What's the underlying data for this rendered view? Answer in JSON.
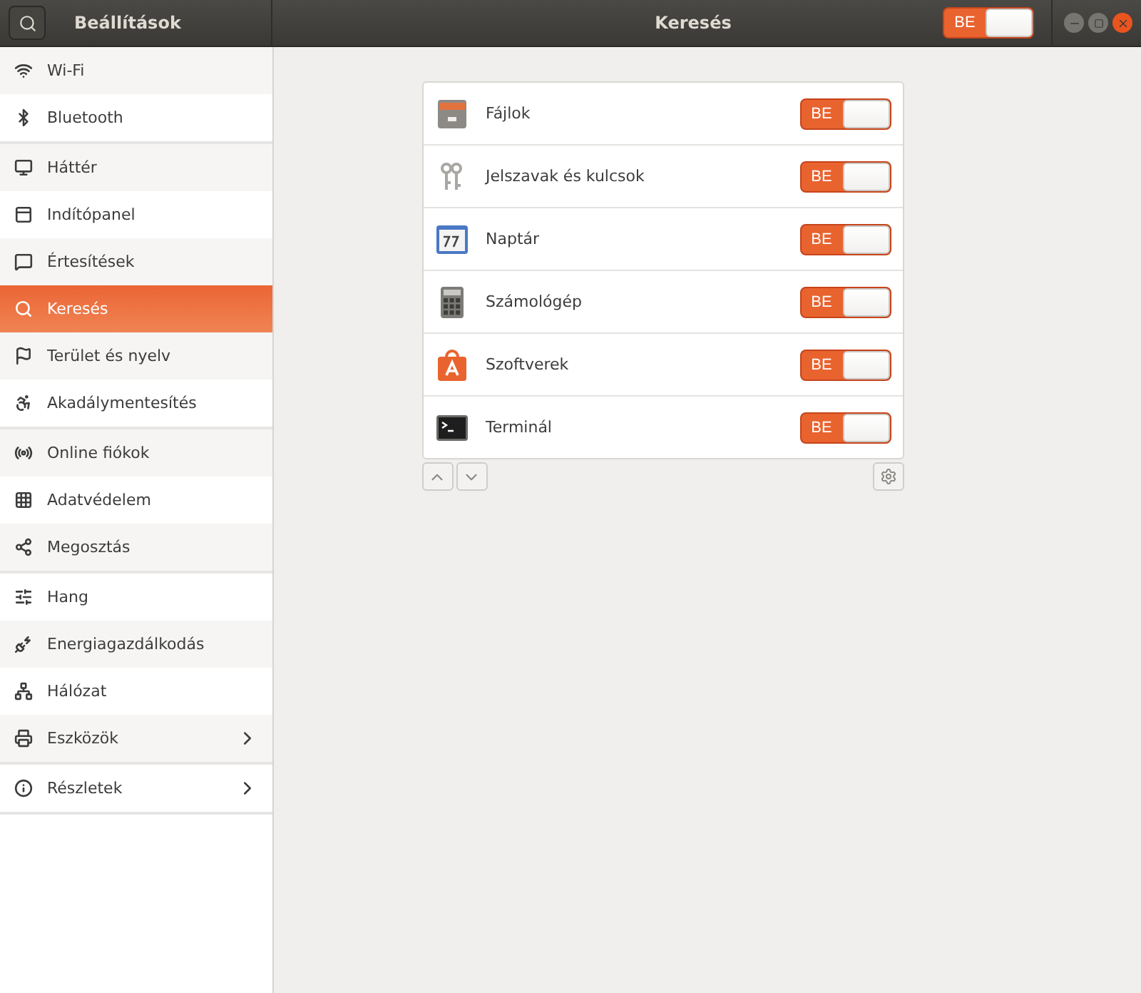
{
  "window": {
    "app_title": "Beállítások",
    "title": "Keresés",
    "master_switch": {
      "label": "BE",
      "on": true
    }
  },
  "sidebar": {
    "sections": [
      {
        "items": [
          {
            "label": "Wi-Fi",
            "selected": false,
            "arrow": false
          },
          {
            "label": "Bluetooth",
            "selected": false,
            "arrow": false
          }
        ]
      },
      {
        "items": [
          {
            "label": "Háttér",
            "selected": false,
            "arrow": false
          },
          {
            "label": "Indítópanel",
            "selected": false,
            "arrow": false
          },
          {
            "label": "Értesítések",
            "selected": false,
            "arrow": false
          },
          {
            "label": "Keresés",
            "selected": true,
            "arrow": false
          },
          {
            "label": "Terület és nyelv",
            "selected": false,
            "arrow": false
          },
          {
            "label": "Akadálymentesítés",
            "selected": false,
            "arrow": false
          }
        ]
      },
      {
        "items": [
          {
            "label": "Online fiókok",
            "selected": false,
            "arrow": false
          },
          {
            "label": "Adatvédelem",
            "selected": false,
            "arrow": false
          },
          {
            "label": "Megosztás",
            "selected": false,
            "arrow": false
          }
        ]
      },
      {
        "items": [
          {
            "label": "Hang",
            "selected": false,
            "arrow": false
          },
          {
            "label": "Energiagazdálkodás",
            "selected": false,
            "arrow": false
          },
          {
            "label": "Hálózat",
            "selected": false,
            "arrow": false
          },
          {
            "label": "Eszközök",
            "selected": false,
            "arrow": true
          }
        ]
      },
      {
        "items": [
          {
            "label": "Részletek",
            "selected": false,
            "arrow": true
          }
        ]
      }
    ]
  },
  "search_providers": [
    {
      "name": "Fájlok",
      "switch_label": "BE",
      "on": true
    },
    {
      "name": "Jelszavak és kulcsok",
      "switch_label": "BE",
      "on": true
    },
    {
      "name": "Naptár",
      "switch_label": "BE",
      "on": true
    },
    {
      "name": "Számológép",
      "switch_label": "BE",
      "on": true
    },
    {
      "name": "Szoftverek",
      "switch_label": "BE",
      "on": true
    },
    {
      "name": "Terminál",
      "switch_label": "BE",
      "on": true
    }
  ]
}
